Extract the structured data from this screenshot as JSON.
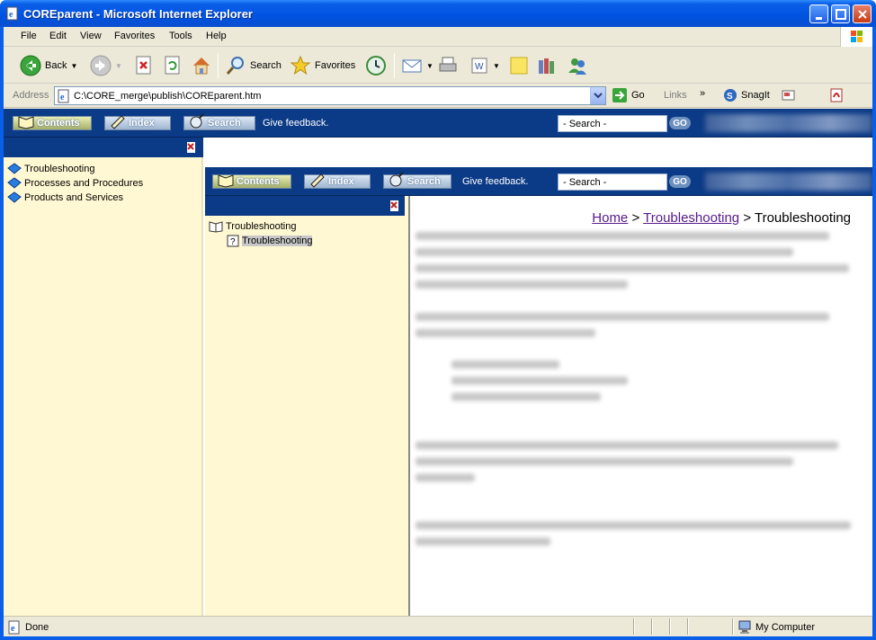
{
  "window": {
    "title": "COREparent - Microsoft Internet Explorer"
  },
  "menu": [
    "File",
    "Edit",
    "View",
    "Favorites",
    "Tools",
    "Help"
  ],
  "toolbar": {
    "back_label": "Back",
    "search_label": "Search",
    "favorites_label": "Favorites"
  },
  "address": {
    "label": "Address",
    "url": "C:\\CORE_merge\\publish\\COREparent.htm",
    "go_label": "Go",
    "links_label": "Links",
    "snagit_label": "SnagIt"
  },
  "outer_nav": {
    "contents": "Contents",
    "index": "Index",
    "search": "Search",
    "feedback": "Give feedback.",
    "search_placeholder": "- Search -",
    "go": "GO"
  },
  "inner_nav": {
    "contents": "Contents",
    "index": "Index",
    "search": "Search",
    "feedback": "Give feedback.",
    "search_placeholder": "- Search -",
    "go": "GO"
  },
  "left_tree": [
    "Troubleshooting",
    "Processes and Procedures",
    "Products and Services"
  ],
  "mid_tree": {
    "book": "Troubleshooting",
    "page": "Troubleshooting"
  },
  "breadcrumb": {
    "home": "Home",
    "sep1": ">",
    "section": "Troubleshooting",
    "sep2": ">",
    "current": "Troubleshooting"
  },
  "status": {
    "left": "Done",
    "right": "My Computer"
  },
  "colors": {
    "title_blue": "#0a5fe8",
    "nav_blue": "#0b3a86",
    "pane_yellow": "#fff8d2",
    "link_purple": "#551a8b"
  }
}
